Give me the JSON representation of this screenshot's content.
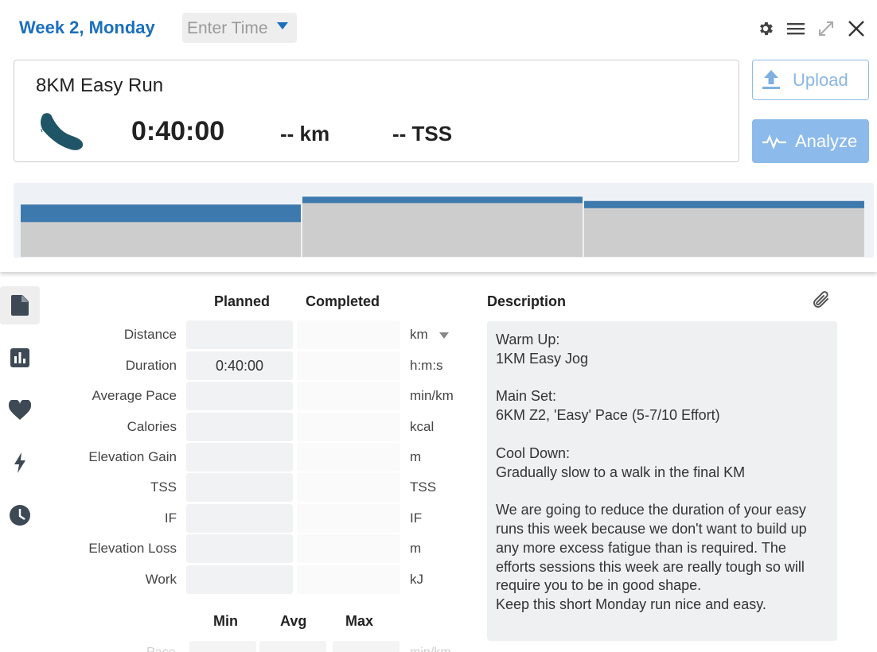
{
  "header": {
    "day_title": "Week 2, Monday",
    "time_placeholder": "Enter Time"
  },
  "summary": {
    "workout_title": "8KM Easy Run",
    "duration": "0:40:00",
    "distance": "-- km",
    "tss": "-- TSS"
  },
  "actions": {
    "upload_label": "Upload",
    "analyze_label": "Analyze"
  },
  "intervals": [
    {
      "duration_fraction": 0.333,
      "intensity": 0.73
    },
    {
      "duration_fraction": 0.333,
      "intensity": 0.84
    },
    {
      "duration_fraction": 0.333,
      "intensity": 0.78
    }
  ],
  "colors": {
    "accent": "#1a6fbd",
    "interval_bar": "#3d79ad",
    "interval_fill": "#cdcdcd",
    "analyze_bg": "#8cbaea"
  },
  "form": {
    "planned_header": "Planned",
    "completed_header": "Completed",
    "rows": [
      {
        "label": "Distance",
        "planned": "",
        "unit": "km"
      },
      {
        "label": "Duration",
        "planned": "0:40:00",
        "unit": "h:m:s"
      },
      {
        "label": "Average Pace",
        "planned": "",
        "unit": "min/km"
      },
      {
        "label": "Calories",
        "planned": "",
        "unit": "kcal"
      },
      {
        "label": "Elevation Gain",
        "planned": "",
        "unit": "m"
      },
      {
        "label": "TSS",
        "planned": "",
        "unit": "TSS"
      },
      {
        "label": "IF",
        "planned": "",
        "unit": "IF"
      },
      {
        "label": "Elevation Loss",
        "planned": "",
        "unit": "m"
      },
      {
        "label": "Work",
        "planned": "",
        "unit": "kJ"
      }
    ],
    "stats_headers": {
      "min": "Min",
      "avg": "Avg",
      "max": "Max"
    },
    "partial_row": {
      "label": "Pace",
      "unit": "min/km"
    }
  },
  "description": {
    "header": "Description",
    "text": "Warm Up:\n1KM Easy Jog\n\nMain Set:\n6KM Z2, 'Easy' Pace (5-7/10 Effort)\n\nCool Down:\nGradually slow to a walk in the final KM\n\nWe are going to reduce the duration of your easy runs this week because we don't want to build up any more excess fatigue than is required. The efforts sessions this week are really tough so will require you to be in good shape.\nKeep this short Monday run nice and easy."
  },
  "sidenav": {
    "items": [
      {
        "icon": "document-icon",
        "active": true
      },
      {
        "icon": "bar-chart-icon",
        "active": false
      },
      {
        "icon": "heart-icon",
        "active": false
      },
      {
        "icon": "lightning-icon",
        "active": false
      },
      {
        "icon": "clock-icon",
        "active": false
      }
    ]
  }
}
